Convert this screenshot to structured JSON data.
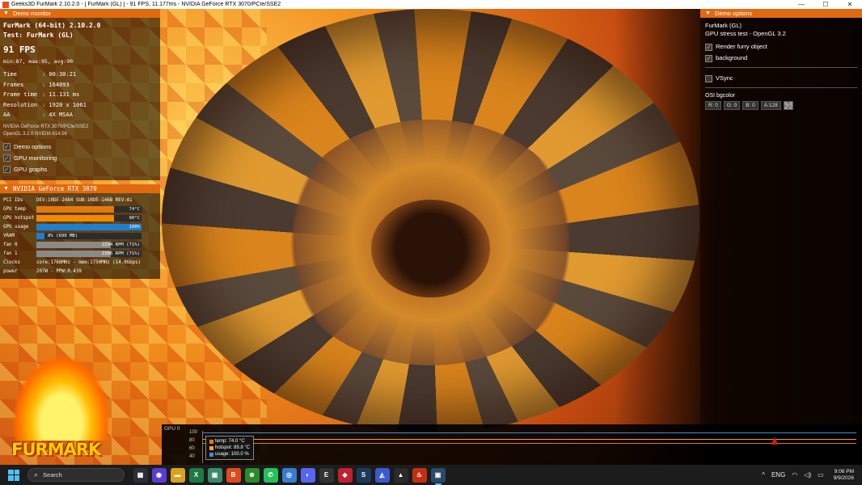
{
  "window": {
    "title": "Geeks3D FurMark 2.10.2.0 - [ FurMark (GL) ] - 91 FPS, 11.177ms - NVIDIA GeForce RTX 3070/PCIe/SSE2",
    "min_icon": "—",
    "max_icon": "☐",
    "close_icon": "✕"
  },
  "demo_monitor": {
    "header": "Demo monitor",
    "app_line": "FurMark (64-bit) 2.10.2.0",
    "test_line": "Test: FurMark (GL)",
    "fps": "91 FPS",
    "minmaxavg": "min:87, max:95, avg:90",
    "stats": [
      {
        "k": "Time",
        "v": ": 00:30:21"
      },
      {
        "k": "Frames",
        "v": ": 164093"
      },
      {
        "k": "Frame time",
        "v": ": 11.131 ms"
      },
      {
        "k": "Resolution",
        "v": ": 1920 x 1061"
      },
      {
        "k": "AA",
        "v": ": 4X MSAA"
      }
    ],
    "renderer": "NVIDIA GeForce RTX 3070/PCIe/SSE2",
    "opengl": "OpenGL 3.2.0 NVIDIA 614.56",
    "options": [
      {
        "label": "Demo options",
        "checked": true
      },
      {
        "label": "GPU monitoring",
        "checked": true
      },
      {
        "label": "GPU graphs",
        "checked": true
      }
    ],
    "check_mark": "✓"
  },
  "gpu_panel": {
    "header": "NVIDIA GeForce RTX 3070",
    "pci_k": "PCI IDs",
    "pci_v": "DEV:10DE-2484 SUB:10DE-146B REV:A1",
    "temp_k": "GPU temp",
    "temp_v": "74°C",
    "temp_frac": 0.74,
    "temp_color": "#e07a10",
    "hot_k": "GPU hotspot",
    "hot_v": "90°C",
    "hot_frac": 0.74,
    "hot_color": "#f08a00",
    "usage_k": "GPU usage",
    "usage_v": "100%",
    "usage_frac": 1.0,
    "usage_color": "#1e7fd0",
    "vram_k": "VRAM",
    "vram_v": "8% (690 MB)",
    "vram_frac": 0.08,
    "vram_color": "#1e7fd0",
    "fan0_k": "fan 0",
    "fan0_v": "2294 RPM (71%)",
    "fan0_frac": 0.71,
    "fan1_k": "fan 1",
    "fan1_v": "2306 RPM (71%)",
    "fan1_frac": 0.71,
    "fan_color": "#8a8a8a",
    "clocks_k": "Clocks",
    "clocks_v": "core:1766MHz - mem:1750MHz (14.0Gbps)",
    "power_k": "power",
    "power_v": "207W - PPW:0.439"
  },
  "logo": {
    "text": "FURMARK"
  },
  "demo_options": {
    "header": "Demo options",
    "name": "FurMark (GL)",
    "desc": "GPU stress test - OpenGL 3.2",
    "render_furry": "Render furry object",
    "background": "background",
    "vsync": "VSync",
    "osi_label": "OSI bgcolor",
    "r": "R: 0",
    "g": "G: 0",
    "b": "B: 0",
    "a": "A:128"
  },
  "graph": {
    "label": "GPU 0",
    "y_ticks": [
      "100",
      "80",
      "60",
      "40"
    ],
    "temp_text": "temp: 74.0 °C",
    "hot_text": "hotspot: 89.8 °C",
    "usage_text": "usage: 100.0 %",
    "temp_color": "#e07a10",
    "hot_color": "#f0a040",
    "usage_color": "#4a8ad0",
    "marker": "▲"
  },
  "taskbar": {
    "search_label": "Search",
    "search_icon": "⌕",
    "apps": [
      {
        "name": "task-view",
        "glyph": "▦",
        "color": "#2d2d3a"
      },
      {
        "name": "widgets",
        "glyph": "◉",
        "color": "#5b3bd4"
      },
      {
        "name": "file-explorer",
        "glyph": "▬",
        "color": "#d9a21c"
      },
      {
        "name": "excel",
        "glyph": "X",
        "color": "#1d7a44"
      },
      {
        "name": "photos",
        "glyph": "▣",
        "color": "#3a8a6a"
      },
      {
        "name": "brave",
        "glyph": "B",
        "color": "#e04a1a"
      },
      {
        "name": "xbox",
        "glyph": "⊗",
        "color": "#2a8a2a"
      },
      {
        "name": "whatsapp",
        "glyph": "✆",
        "color": "#25c05a"
      },
      {
        "name": "chrome",
        "glyph": "◎",
        "color": "#3a7ad0"
      },
      {
        "name": "discord",
        "glyph": "◐",
        "color": "#5865f2"
      },
      {
        "name": "epic",
        "glyph": "E",
        "color": "#333"
      },
      {
        "name": "game-launcher",
        "glyph": "◆",
        "color": "#c02030"
      },
      {
        "name": "steam",
        "glyph": "S",
        "color": "#1b3a5a"
      },
      {
        "name": "ea",
        "glyph": "◭",
        "color": "#3a5ad0"
      },
      {
        "name": "store",
        "glyph": "▲",
        "color": "#2a2a2a"
      },
      {
        "name": "furmark-app",
        "glyph": "♨",
        "color": "#c03010"
      },
      {
        "name": "active-window",
        "glyph": "▣",
        "color": "#2a4a6a"
      }
    ],
    "tray_chevron": "^",
    "lang": "ENG",
    "wifi_icon": "◠",
    "volume_icon": "◁)",
    "battery_icon": "▭",
    "time": "9:06 PM",
    "date": "9/9/2026"
  }
}
